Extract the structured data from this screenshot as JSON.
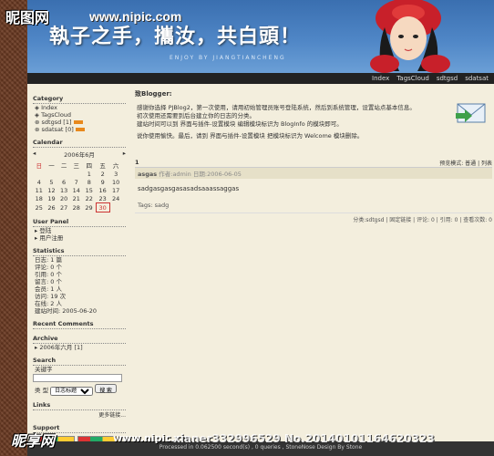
{
  "watermark": {
    "top_logo": "昵图网",
    "top_url": "www.nipic.com",
    "bottom_logo": "昵享网",
    "bottom_url": "www.nipic.cn",
    "id_text": "xianer332996529 No.20140101164620323"
  },
  "banner": {
    "title": "執子之手，攜汝，共白頭！",
    "subtitle": "ENJOY BY JIANGTIANCHENG"
  },
  "nav": [
    "Index",
    "TagsCloud",
    "sdtgsd",
    "sdatsat"
  ],
  "sidebar": {
    "category": {
      "heading": "Category",
      "items": [
        "Index",
        "TagsCloud",
        "sdtgsd [1]",
        "sdatsat [0]"
      ]
    },
    "calendar": {
      "heading": "Calendar",
      "month": "2006年6月",
      "weekdays": [
        "日",
        "一",
        "二",
        "三",
        "四",
        "五",
        "六"
      ],
      "rows": [
        [
          "",
          "",
          "",
          "",
          "1",
          "2",
          "3"
        ],
        [
          "4",
          "5",
          "6",
          "7",
          "8",
          "9",
          "10"
        ],
        [
          "11",
          "12",
          "13",
          "14",
          "15",
          "16",
          "17"
        ],
        [
          "18",
          "19",
          "20",
          "21",
          "22",
          "23",
          "24"
        ],
        [
          "25",
          "26",
          "27",
          "28",
          "29",
          "30",
          ""
        ]
      ],
      "today": "30"
    },
    "user_panel": {
      "heading": "User Panel",
      "items": [
        "登陆",
        "用户注册"
      ]
    },
    "statistics": {
      "heading": "Statistics",
      "items": [
        "日志: 1 篇",
        "评论: 0 个",
        "引用: 0 个",
        "留言: 0 个",
        "会员: 1 人",
        "访问: 19 次",
        "在线: 2 人",
        "建站时间: 2005-06-20"
      ]
    },
    "recent_comments": {
      "heading": "Recent Comments"
    },
    "archive": {
      "heading": "Archive",
      "items": [
        "2006年六月 [1]"
      ]
    },
    "search": {
      "heading": "Search",
      "keyword_label": "关键字",
      "type_label": "类   型",
      "type_value": "日志标题",
      "button": "搜 索"
    },
    "links": {
      "heading": "Links",
      "more": "更多链接..."
    },
    "support": {
      "heading": "Support"
    }
  },
  "main": {
    "blogger_label": "致Blogger:",
    "welcome_lines": [
      "感谢你选择 PJBlog2，第一次使用，请用初始管理员账号登陆系统，然后到系统管理，设置站点基本信息。",
      "初次使用还需要到后台建立你的日志的分类。",
      "建站时间可以到 界面与插件-设置模块 编辑模块标识为 BlogInfo 的模块即可。",
      "说你使用愉快。最后，请到 界面与插件-设置模块 把模块标识为 Welcome 模块删除。"
    ],
    "post": {
      "index": "1",
      "view_mode": "预览模式: 普通 | 列表",
      "title": "asgas",
      "meta": "作者:admin 日期:2006-06-05",
      "body": "sadgasgasgasasadsaaassaggas",
      "tags": "Tags: sadg",
      "footer": "分类:sdtgsd | 固定链接 | 评论: 0 | 引用: 0 | 查看次数: 0"
    }
  },
  "footer": {
    "text": "Processed in 0.062500 second(s) , 0 queries , StoneNose Design By Stone"
  }
}
